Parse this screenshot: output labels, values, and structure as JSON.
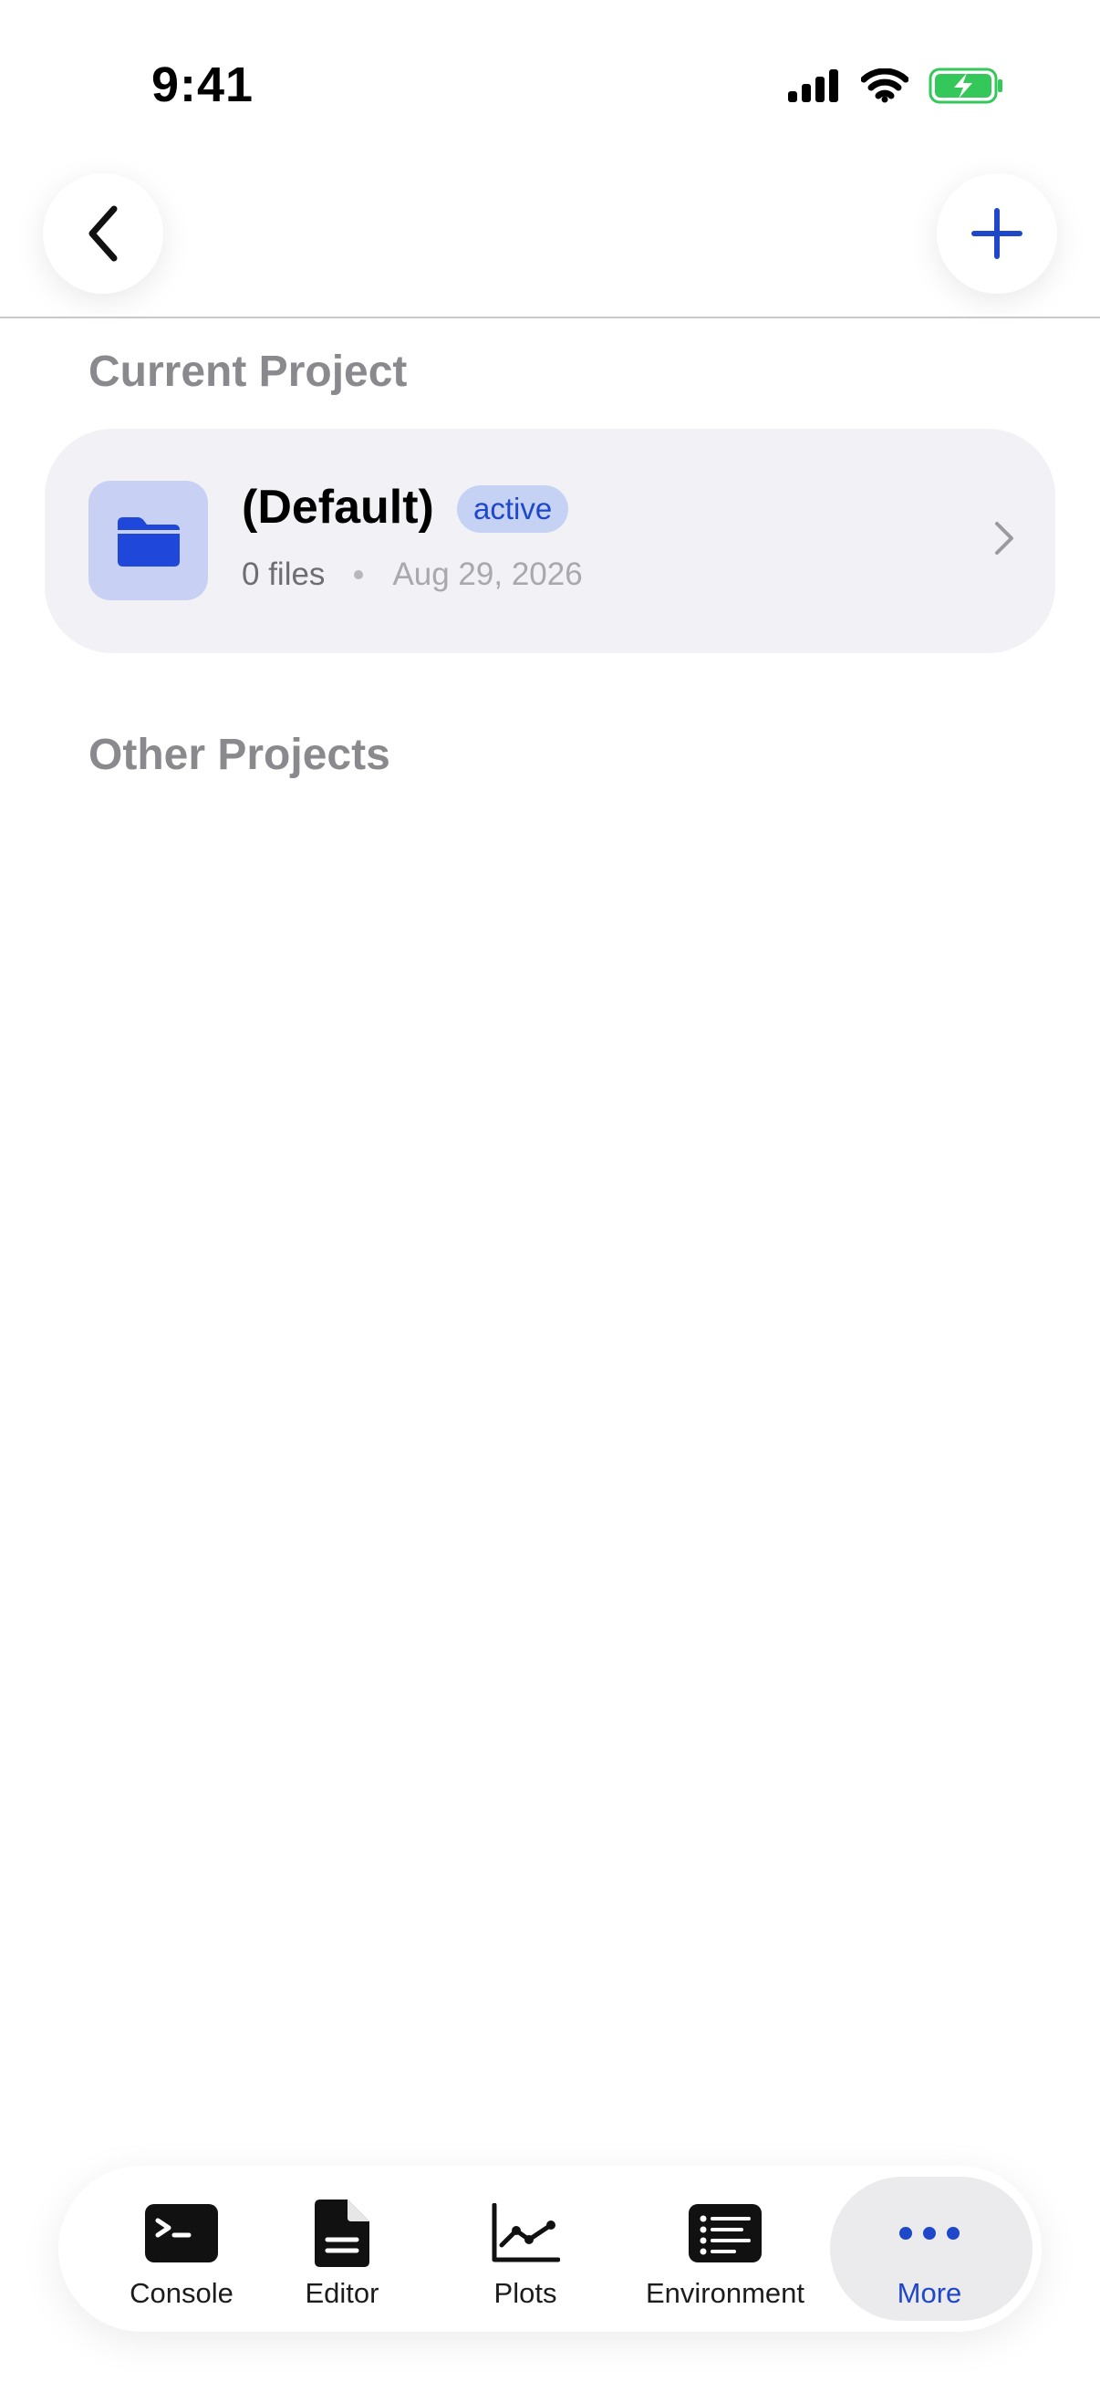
{
  "status": {
    "time": "9:41"
  },
  "sections": {
    "current_title": "Current Project",
    "other_title": "Other Projects"
  },
  "current_project": {
    "name": "(Default)",
    "badge": "active",
    "files": "0 files",
    "date": "Aug 29, 2026"
  },
  "tabs": [
    {
      "label": "Console",
      "icon": "terminal-icon"
    },
    {
      "label": "Editor",
      "icon": "document-icon"
    },
    {
      "label": "Plots",
      "icon": "line-chart-icon"
    },
    {
      "label": "Environment",
      "icon": "list-icon"
    },
    {
      "label": "More",
      "icon": "ellipsis-icon",
      "selected": true
    }
  ],
  "colors": {
    "accent": "#1f47c9",
    "battery": "#34c759",
    "card": "#f1f1f6"
  }
}
